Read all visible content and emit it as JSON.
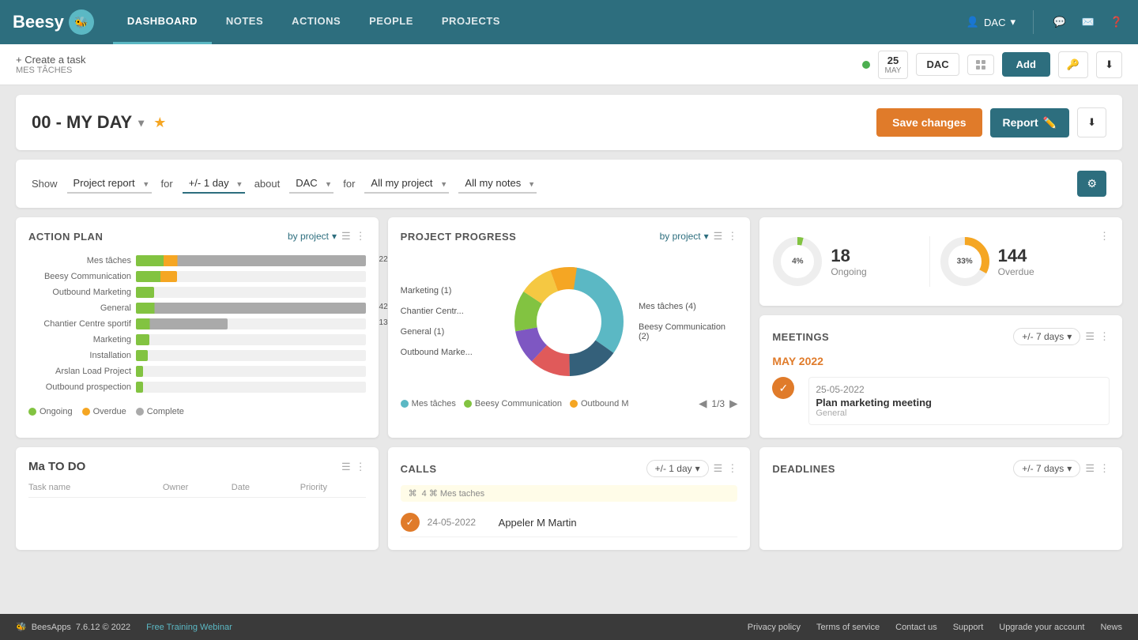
{
  "nav": {
    "logo_text": "Beesy",
    "items": [
      {
        "label": "DASHBOARD",
        "active": true
      },
      {
        "label": "NOTES",
        "active": false
      },
      {
        "label": "ACTIONS",
        "active": false
      },
      {
        "label": "PEOPLE",
        "active": false
      },
      {
        "label": "PROJECTS",
        "active": false
      }
    ],
    "user": "DAC",
    "icons": [
      "user-icon",
      "chat-icon",
      "mail-icon",
      "help-icon"
    ]
  },
  "toolbar": {
    "create_label": "+ Create a task",
    "create_sub": "MES TÂCHES",
    "date_day": "25",
    "date_month": "MAY",
    "dac_label": "DAC",
    "add_label": "Add"
  },
  "page_header": {
    "title": "00 - MY DAY",
    "save_label": "Save changes",
    "report_label": "Report",
    "download_icon": "download-icon"
  },
  "filter_bar": {
    "show_label": "Show",
    "show_value": "Project report",
    "for_label_1": "for",
    "for_value_1": "+/- 1 day",
    "about_label": "about",
    "about_value": "DAC",
    "for_label_2": "for",
    "for_value_2": "All my project",
    "notes_value": "All my notes",
    "gear_icon": "gear-icon"
  },
  "action_plan": {
    "title": "ACTION PLAN",
    "by_project_label": "by project",
    "bars": [
      {
        "label": "Mes tâches",
        "green": 5,
        "yellow": 2,
        "grey": 22,
        "total": 22
      },
      {
        "label": "Beesy Communication",
        "green": 4,
        "yellow": 2,
        "grey": 0,
        "total": 0
      },
      {
        "label": "Outbound Marketing",
        "green": 2,
        "yellow": 0,
        "grey": 0,
        "total": 0
      },
      {
        "label": "General",
        "green": 3,
        "yellow": 0,
        "grey": 42,
        "total": 42
      },
      {
        "label": "Chantier Centre sportif",
        "green": 3,
        "yellow": 0,
        "grey": 13,
        "total": 13
      },
      {
        "label": "Marketing",
        "green": 2,
        "yellow": 0,
        "grey": 0,
        "total": 0
      },
      {
        "label": "Installation",
        "green": 2,
        "yellow": 0,
        "grey": 0,
        "total": 0
      },
      {
        "label": "Arslan Load Project",
        "green": 1,
        "yellow": 0,
        "grey": 0,
        "total": 0
      },
      {
        "label": "Outbound prospection",
        "green": 1,
        "yellow": 0,
        "grey": 0,
        "total": 0
      }
    ],
    "legend": [
      {
        "color": "#82c341",
        "label": "Ongoing"
      },
      {
        "color": "#f5a623",
        "label": "Overdue"
      },
      {
        "color": "#aaa",
        "label": "Complete"
      }
    ]
  },
  "project_progress": {
    "title": "PROJECT PROGRESS",
    "by_project_label": "by project",
    "left_labels": [
      "Marketing (1)",
      "Chantier Centr...",
      "General (1)",
      "Outbound Marke..."
    ],
    "right_labels": [
      "Mes tâches (4)",
      "Beesy Communication (2)"
    ],
    "legend_items": [
      "Mes tâches",
      "Beesy Communication",
      "Outbound M"
    ],
    "pagination": "1/3"
  },
  "stats": {
    "ongoing_percent": 4,
    "ongoing_count": 18,
    "ongoing_label": "Ongoing",
    "overdue_percent": 33,
    "overdue_count": 144,
    "overdue_label": "Overdue"
  },
  "meetings": {
    "title": "MEETINGS",
    "filter_label": "+/- 7 days",
    "month_label": "MAY 2022",
    "items": [
      {
        "date": "25-05-2022",
        "title": "Plan marketing meeting",
        "sub": "General",
        "checked": true
      }
    ]
  },
  "todo": {
    "title": "Ma TO DO",
    "columns": [
      "Task name",
      "Owner",
      "Date",
      "Priority"
    ]
  },
  "calls": {
    "title": "CALLS",
    "filter_label": "+/- 1 day",
    "note_label": "4 ⌘ Mes taches",
    "items": [
      {
        "date": "24-05-2022",
        "name": "Appeler M Martin",
        "checked": true
      }
    ]
  },
  "deadlines": {
    "title": "DEADLINES",
    "filter_label": "+/- 7 days"
  },
  "footer": {
    "logo": "BeesApps",
    "version": "7.6.12 © 2022",
    "webinar": "Free Training Webinar",
    "links": [
      "Privacy policy",
      "Terms of service",
      "Contact us",
      "Support",
      "Upgrade your account",
      "News"
    ]
  }
}
